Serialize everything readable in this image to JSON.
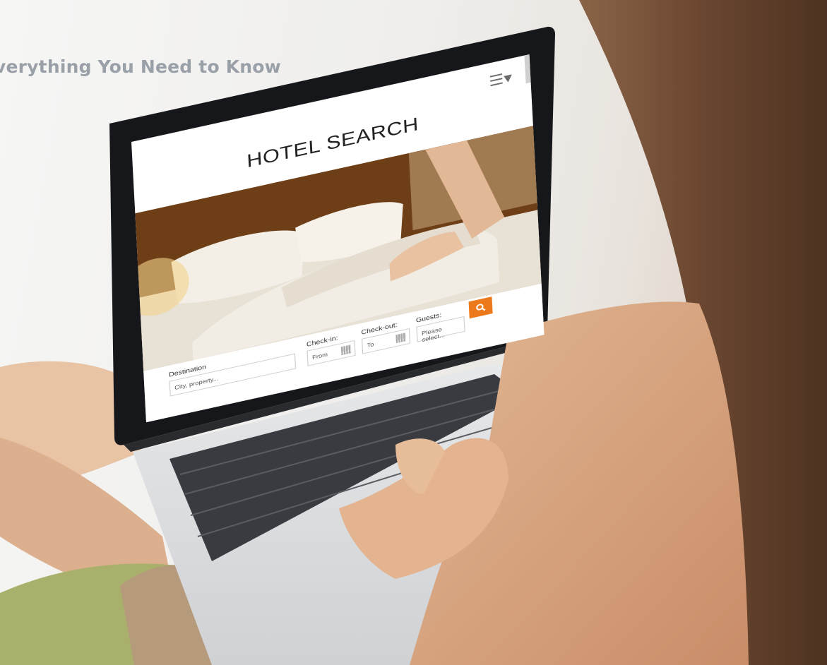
{
  "article": {
    "title": "Everything You Need to Know",
    "visible_title": "verything You Need to Know"
  },
  "screen": {
    "menu_icon": "hamburger-menu-icon",
    "site_title": "HOTEL SEARCH",
    "form": {
      "destination_label": "Destination",
      "destination_placeholder": "City, property...",
      "checkin_label": "Check-in:",
      "checkin_value": "From",
      "checkout_label": "Check-out:",
      "checkout_value": "To",
      "guests_label": "Guests:",
      "guests_value": "Please select...",
      "search_icon": "search-icon"
    }
  },
  "colors": {
    "accent": "#ec7a1c",
    "title_overlay": "#9aa0a8"
  }
}
